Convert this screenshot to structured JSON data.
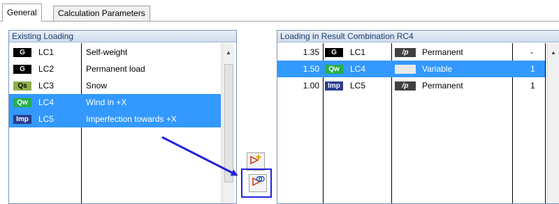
{
  "tabs": [
    {
      "label": "General"
    },
    {
      "label": "Calculation Parameters"
    }
  ],
  "existing_loading": {
    "title": "Existing Loading",
    "rows": [
      {
        "badge": "G",
        "lc": "LC1",
        "desc": "Self-weight",
        "selected": false
      },
      {
        "badge": "G",
        "lc": "LC2",
        "desc": "Permanent load",
        "selected": false
      },
      {
        "badge": "Qs",
        "lc": "LC3",
        "desc": "Snow",
        "selected": false
      },
      {
        "badge": "Qw",
        "lc": "LC4",
        "desc": "Wind in +X",
        "selected": true
      },
      {
        "badge": "Imp",
        "lc": "LC5",
        "desc": "Imperfection towards +X",
        "selected": true
      }
    ]
  },
  "result_combination": {
    "title": "Loading in Result Combination RC4",
    "rows": [
      {
        "factor": "1.35",
        "badge": "G",
        "lc": "LC1",
        "action_badge": "/p",
        "action": "Permanent",
        "flag": "-",
        "selected": false
      },
      {
        "factor": "1.50",
        "badge": "Qw",
        "lc": "LC4",
        "action_badge": "",
        "action": "Variable",
        "flag": "1",
        "selected": true
      },
      {
        "factor": "1.00",
        "badge": "Imp",
        "lc": "LC5",
        "action_badge": "/p",
        "action": "Permanent",
        "flag": "1",
        "selected": false
      }
    ]
  },
  "buttons": {
    "add_icon": "add-to-combination-icon",
    "add_alt_icon": "add-alternative-icon"
  },
  "colors": {
    "selection": "#3399ff",
    "annotation": "#2222dd",
    "badge_g": "#000000",
    "badge_qs": "#8faf4a",
    "badge_qw": "#25b04a",
    "badge_imp": "#2a3d8f"
  }
}
